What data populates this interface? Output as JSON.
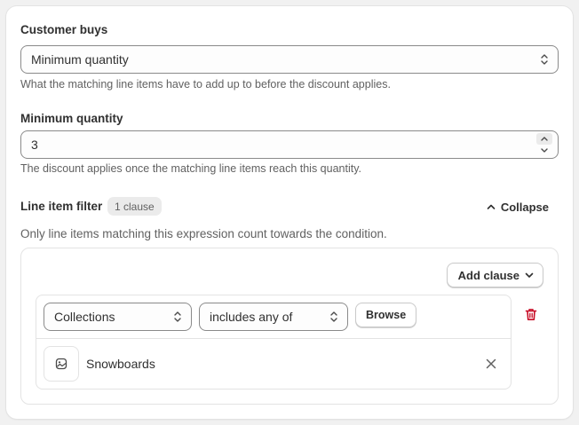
{
  "customer_buys": {
    "label": "Customer buys",
    "selected": "Minimum quantity",
    "help": "What the matching line items have to add up to before the discount applies."
  },
  "minimum_quantity": {
    "label": "Minimum quantity",
    "value": "3",
    "help": "The discount applies once the matching line items reach this quantity."
  },
  "line_item_filter": {
    "title": "Line item filter",
    "badge": "1 clause",
    "collapse_label": "Collapse",
    "description": "Only line items matching this expression count towards the condition.",
    "add_clause_label": "Add clause",
    "clause": {
      "field": "Collections",
      "operator": "includes any of",
      "browse_label": "Browse",
      "items": [
        {
          "label": "Snowboards",
          "icon": "image-icon"
        }
      ]
    }
  },
  "colors": {
    "danger": "#c70a24",
    "text": "#303030",
    "subdued": "#616161",
    "border": "#8a8a8a"
  }
}
